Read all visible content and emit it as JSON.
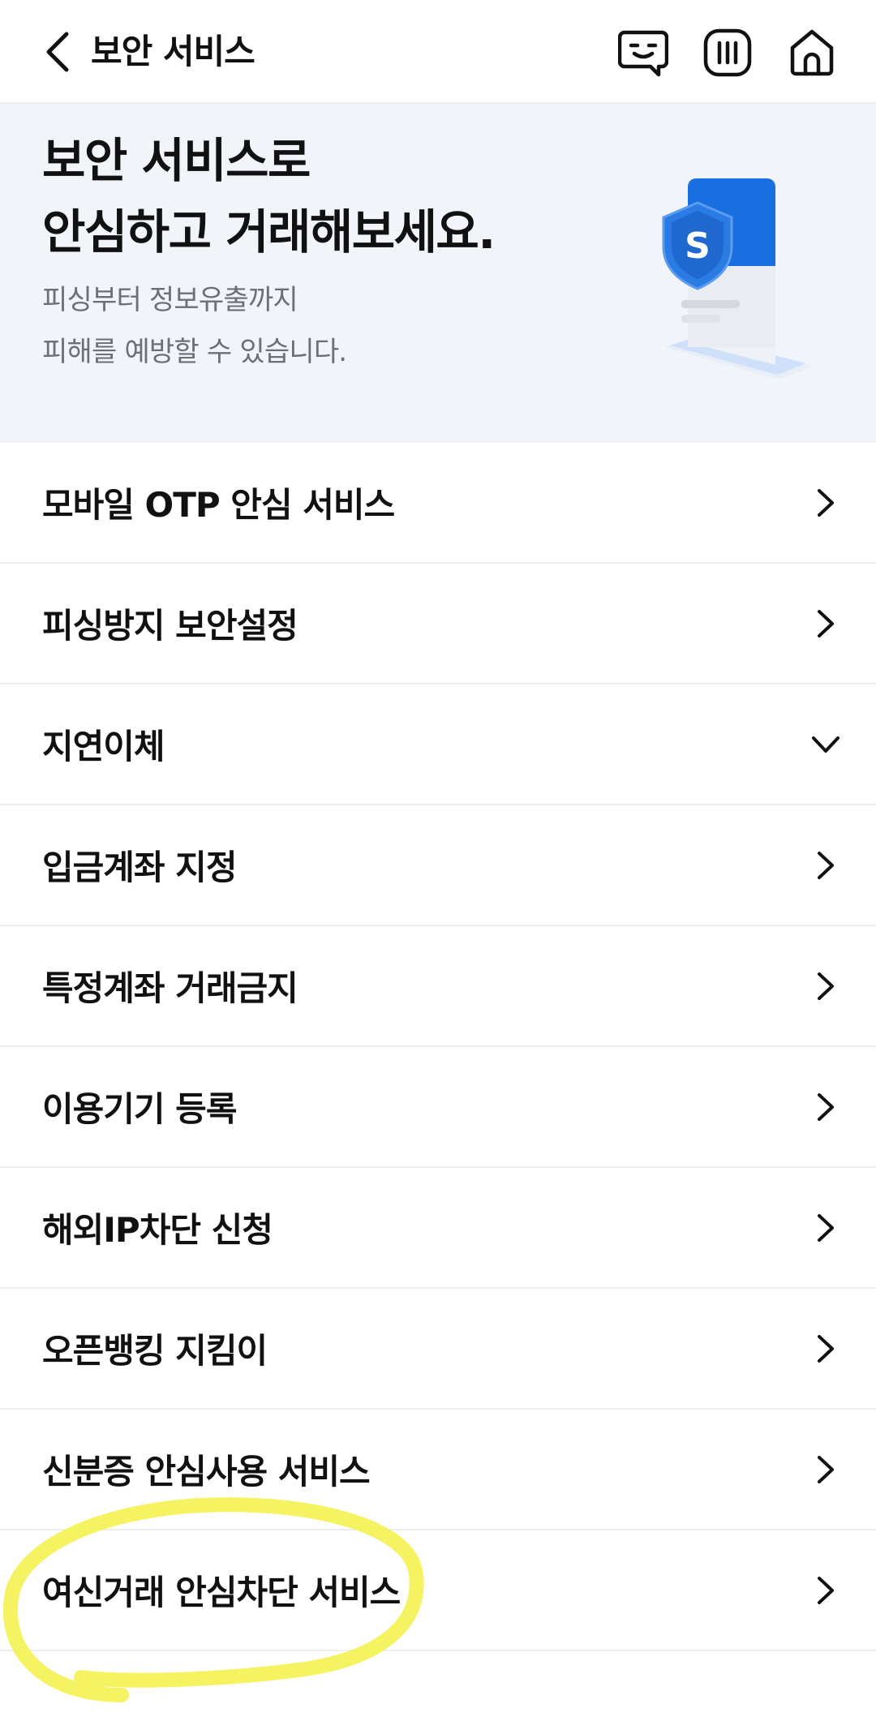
{
  "header": {
    "title": "보안 서비스",
    "icons": [
      "back-icon",
      "chatbot-icon",
      "menu-icon",
      "home-icon"
    ]
  },
  "hero": {
    "title_line1": "보안 서비스로",
    "title_line2": "안심하고 거래해보세요.",
    "desc_line1": "피싱부터 정보유출까지",
    "desc_line2": "피해를 예방할 수 있습니다.",
    "illustration": "shield-phone-illustration",
    "shield_letter": "S"
  },
  "menu": {
    "items": [
      {
        "label": "모바일 OTP 안심 서비스",
        "icon": "chevron-right-icon"
      },
      {
        "label": "피싱방지 보안설정",
        "icon": "chevron-right-icon"
      },
      {
        "label": "지연이체",
        "icon": "chevron-down-icon"
      },
      {
        "label": "입금계좌 지정",
        "icon": "chevron-right-icon"
      },
      {
        "label": "특정계좌 거래금지",
        "icon": "chevron-right-icon"
      },
      {
        "label": "이용기기 등록",
        "icon": "chevron-right-icon"
      },
      {
        "label": "해외IP차단 신청",
        "icon": "chevron-right-icon"
      },
      {
        "label": "오픈뱅킹 지킴이",
        "icon": "chevron-right-icon"
      },
      {
        "label": "신분증 안심사용 서비스",
        "icon": "chevron-right-icon"
      },
      {
        "label": "여신거래 안심차단 서비스",
        "icon": "chevron-right-icon"
      }
    ]
  },
  "colors": {
    "hero_bg": "#f1f4f8",
    "accent_blue": "#1a6fe0",
    "highlight": "#f4f25a",
    "divider": "#eceef1"
  }
}
